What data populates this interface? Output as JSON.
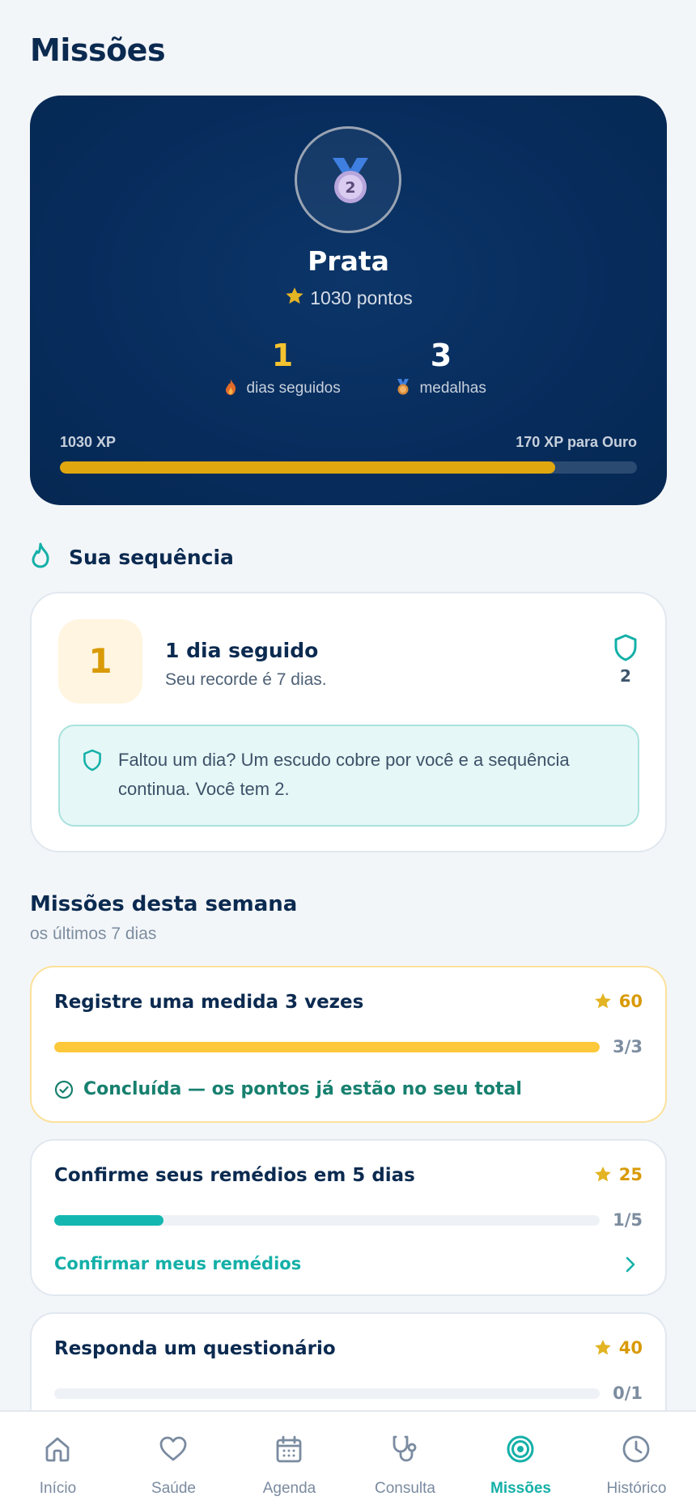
{
  "page": {
    "title": "Missões"
  },
  "hero": {
    "tier": "Prata",
    "medal_number": "2",
    "points_text": "1030 pontos",
    "streak_value": "1",
    "streak_label": "dias seguidos",
    "medals_value": "3",
    "medals_label": "medalhas",
    "xp_current": "1030 XP",
    "xp_remaining": "170 XP para Ouro",
    "xp_progress": 0.858
  },
  "streak_section": {
    "heading": "Sua sequência",
    "days_value": "1",
    "title": "1 dia seguido",
    "subtitle": "Seu recorde é 7 dias.",
    "shields_count": "2",
    "info_text": "Faltou um dia? Um escudo cobre por você e a sequência continua. Você tem 2."
  },
  "weekly": {
    "title": "Missões desta semana",
    "subtitle": "os últimos 7 dias",
    "missions": [
      {
        "title": "Registre uma medida 3 vezes",
        "points": "60",
        "progress_text": "3/3",
        "progress": 1.0,
        "status": "Concluída — os pontos já estão no seu total",
        "bar_color": "#fdc83a"
      },
      {
        "title": "Confirme seus remédios em 5 dias",
        "points": "25",
        "progress_text": "1/5",
        "progress": 0.2,
        "action": "Confirmar meus remédios",
        "bar_color": "#14b7b0"
      },
      {
        "title": "Responda um questionário",
        "points": "40",
        "progress_text": "0/1",
        "progress": 0.0,
        "bar_color": "#14b7b0"
      }
    ]
  },
  "tabbar": {
    "items": [
      {
        "label": "Início",
        "icon": "home-icon"
      },
      {
        "label": "Saúde",
        "icon": "heart-icon"
      },
      {
        "label": "Agenda",
        "icon": "calendar-icon"
      },
      {
        "label": "Consulta",
        "icon": "stethoscope-icon"
      },
      {
        "label": "Missões",
        "icon": "target-icon",
        "active": true
      },
      {
        "label": "Histórico",
        "icon": "clock-icon"
      }
    ]
  },
  "colors": {
    "accent": "#14b0a8",
    "hero_bg": "#072c5c",
    "gold": "#e0a70f"
  }
}
